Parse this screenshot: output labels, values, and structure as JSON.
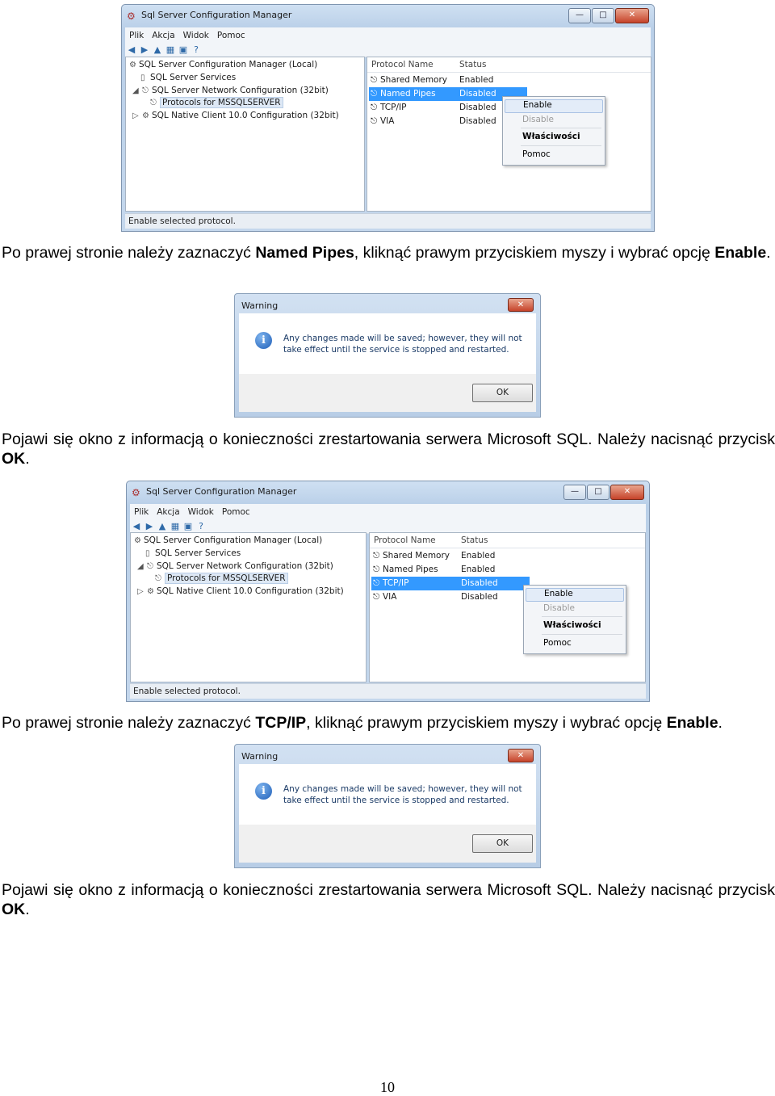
{
  "window": {
    "title": "Sql Server Configuration Manager",
    "menu": [
      "Plik",
      "Akcja",
      "Widok",
      "Pomoc"
    ],
    "tree": [
      "SQL Server Configuration Manager (Local)",
      "SQL Server Services",
      "SQL Server Network Configuration (32bit)",
      "Protocols for MSSQLSERVER",
      "SQL Native Client 10.0 Configuration (32bit)"
    ],
    "columns": [
      "Protocol Name",
      "Status"
    ],
    "status_text": "Enable selected protocol.",
    "context_menu": [
      "Enable",
      "Disable",
      "Właściwości",
      "Pomoc"
    ]
  },
  "screens": [
    {
      "rows": [
        {
          "name": "Shared Memory",
          "status": "Enabled"
        },
        {
          "name": "Named Pipes",
          "status": "Disabled"
        },
        {
          "name": "TCP/IP",
          "status": "Disabled"
        },
        {
          "name": "VIA",
          "status": "Disabled"
        }
      ],
      "selected_row": 1
    },
    {
      "rows": [
        {
          "name": "Shared Memory",
          "status": "Enabled"
        },
        {
          "name": "Named Pipes",
          "status": "Enabled"
        },
        {
          "name": "TCP/IP",
          "status": "Disabled"
        },
        {
          "name": "VIA",
          "status": "Disabled"
        }
      ],
      "selected_row": 2
    }
  ],
  "dialog": {
    "title": "Warning",
    "message": "Any changes made will be saved; however, they will not take effect until the service is stopped and restarted.",
    "ok_label": "OK"
  },
  "paragraphs": {
    "p1": {
      "a": "Po prawej stronie należy zaznaczyć ",
      "b": "Named Pipes",
      "c": ", kliknąć prawym przyciskiem myszy i wybrać opcję ",
      "d": "Enable",
      "e": "."
    },
    "p2": {
      "a": "Pojawi się okno z informacją o konieczności zrestartowania serwera Microsoft SQL. Należy nacisnąć przycisk ",
      "b": "OK",
      "c": "."
    },
    "p3": {
      "a": "Po prawej stronie należy zaznaczyć ",
      "b": "TCP/IP",
      "c": ", kliknąć prawym przyciskiem myszy i wybrać opcję ",
      "d": "Enable",
      "e": "."
    },
    "p4": {
      "a": "Pojawi się okno z informacją o konieczności zrestartowania serwera Microsoft SQL. Należy nacisnąć przycisk ",
      "b": "OK",
      "c": "."
    }
  },
  "page_number": "10"
}
